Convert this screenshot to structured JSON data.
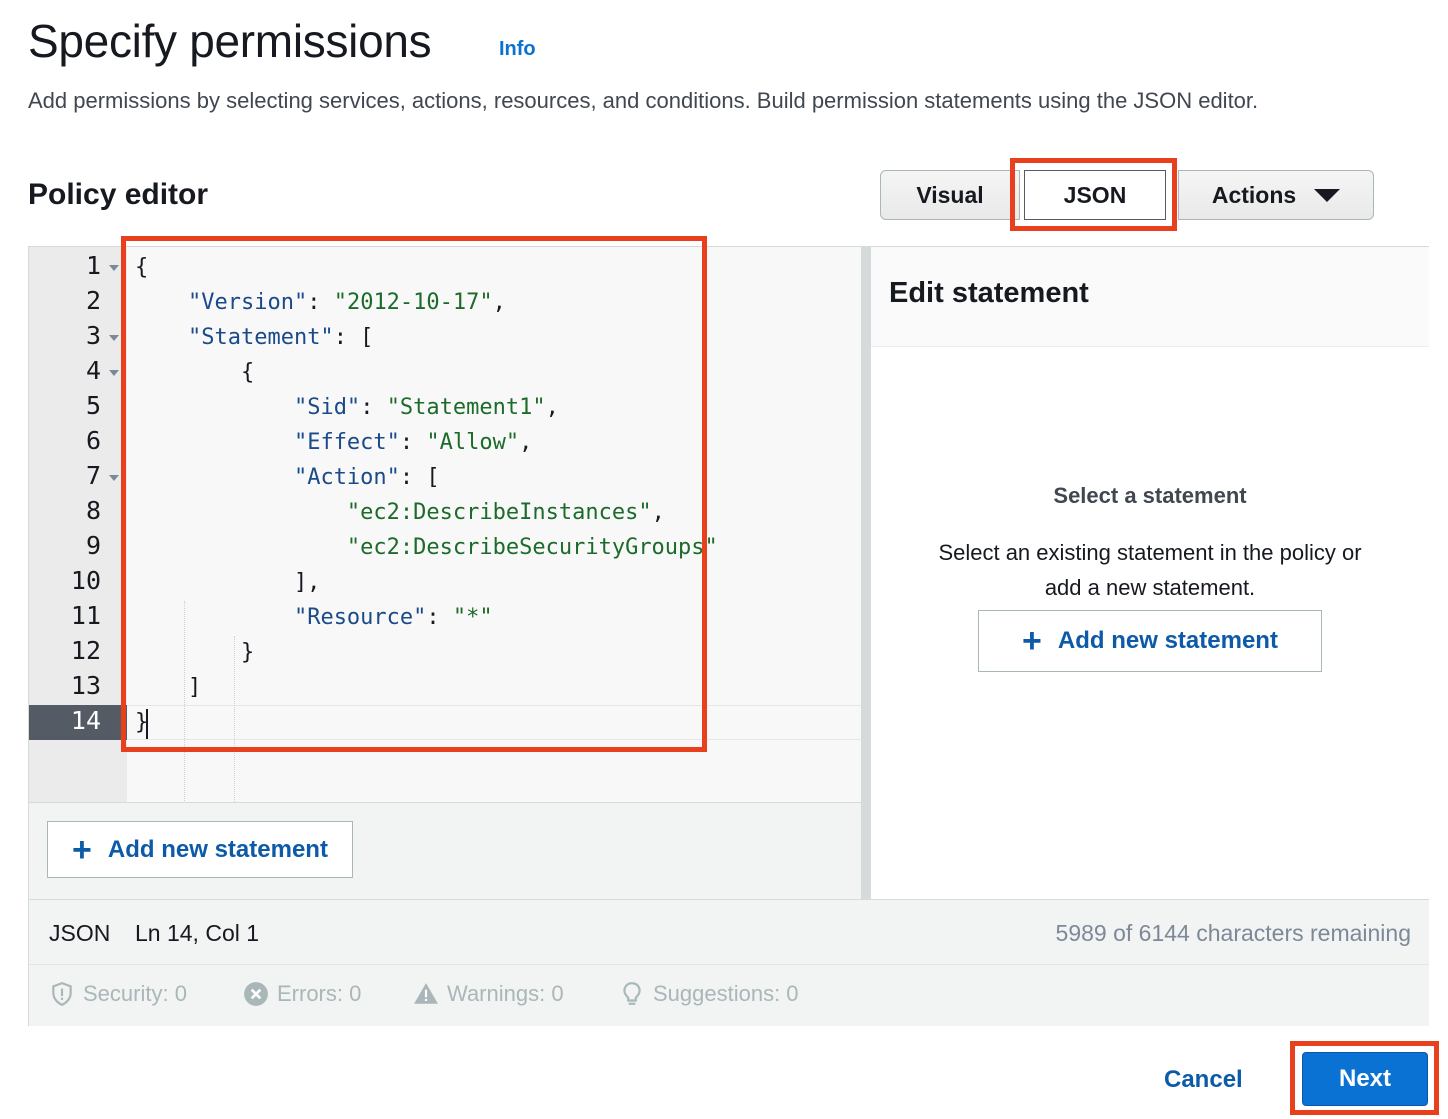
{
  "page": {
    "title": "Specify permissions",
    "info_link": "Info",
    "description": "Add permissions by selecting services, actions, resources, and conditions. Build permission statements using the JSON editor."
  },
  "policy_editor": {
    "title": "Policy editor",
    "mode_tabs": [
      {
        "label": "Visual",
        "selected": false
      },
      {
        "label": "JSON",
        "selected": true
      },
      {
        "label": "Actions",
        "selected": false
      }
    ],
    "line_numbers": [
      "1",
      "2",
      "3",
      "4",
      "5",
      "6",
      "7",
      "8",
      "9",
      "10",
      "11",
      "12",
      "13",
      "14"
    ],
    "code_lines": [
      "{",
      "    \"Version\": \"2012-10-17\",",
      "    \"Statement\": [",
      "        {",
      "            \"Sid\": \"Statement1\",",
      "            \"Effect\": \"Allow\",",
      "            \"Action\": [",
      "                \"ec2:DescribeInstances\",",
      "                \"ec2:DescribeSecurityGroups\"",
      "            ],",
      "            \"Resource\": \"*\"",
      "        }",
      "    ]",
      "}"
    ],
    "code_tokens": {
      "version_key": "\"Version\"",
      "version_val": "\"2012-10-17\"",
      "statement_key": "\"Statement\"",
      "sid_key": "\"Sid\"",
      "sid_val": "\"Statement1\"",
      "effect_key": "\"Effect\"",
      "effect_val": "\"Allow\"",
      "action_key": "\"Action\"",
      "action_1": "\"ec2:DescribeInstances\"",
      "action_2": "\"ec2:DescribeSecurityGroups\"",
      "resource_key": "\"Resource\"",
      "resource_val": "\"*\""
    },
    "add_statement_label": "Add new statement",
    "active_line": "14"
  },
  "edit_statement": {
    "title": "Edit statement",
    "empty_title": "Select a statement",
    "empty_text_line1": "Select an existing statement in the policy or",
    "empty_text_line2": "add a new statement.",
    "add_statement_label": "Add new statement"
  },
  "status_bar": {
    "language": "JSON",
    "position": "Ln 14, Col 1",
    "characters_remaining": "5989 of 6144 characters remaining"
  },
  "checks": {
    "security": "Security: 0",
    "errors": "Errors: 0",
    "warnings": "Warnings: 0",
    "suggestions": "Suggestions: 0"
  },
  "footer": {
    "cancel_label": "Cancel",
    "next_label": "Next"
  },
  "colors": {
    "accent": "#0972d3",
    "highlight": "#e8401c",
    "string": "#1d6b2a",
    "key": "#1a4a8a"
  }
}
